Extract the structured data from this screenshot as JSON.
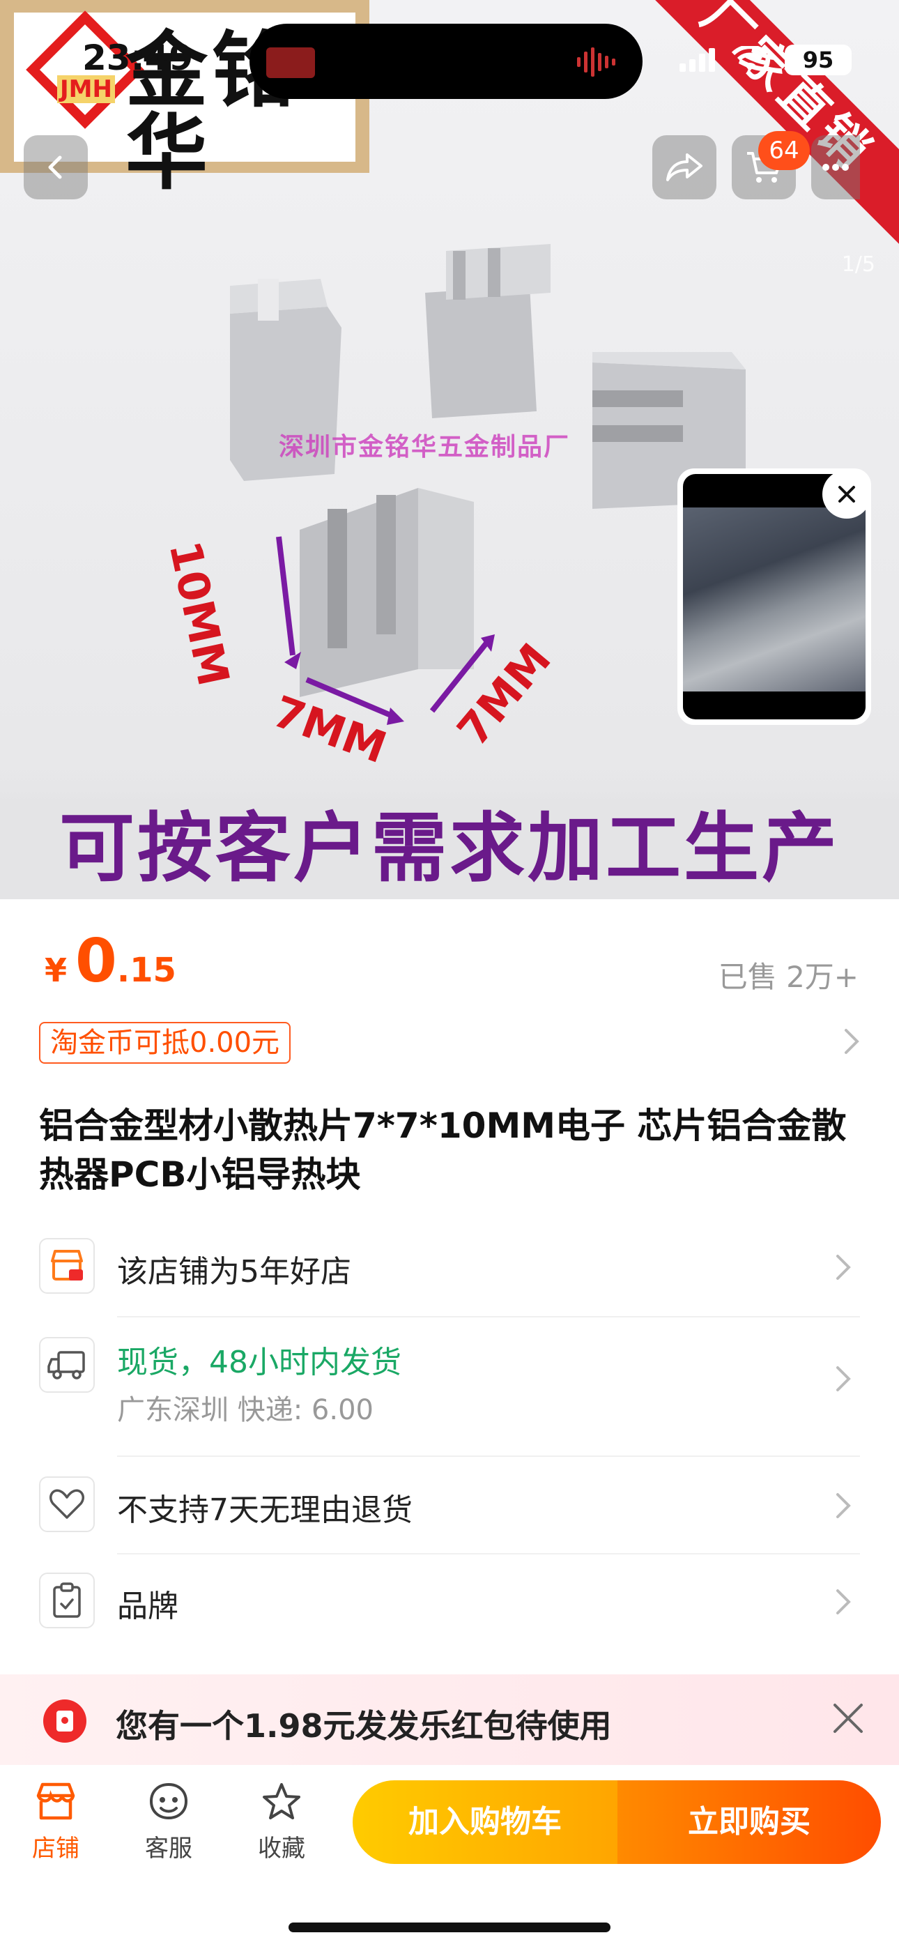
{
  "status_bar": {
    "time": "23:49",
    "battery": "95"
  },
  "hero": {
    "logo_text": "金铭华",
    "logo_badge": "JMH",
    "ribbon_text": "厂家直销",
    "watermark": "深圳市金铭华五金制品厂",
    "dim_height": "10MM",
    "dim_width": "7MM",
    "dim_depth": "7MM",
    "caption": "可按客户需求加工生产",
    "image_counter": "1/5",
    "cart_badge": "64"
  },
  "product": {
    "currency": "¥",
    "price_int": "0",
    "price_dec": ".15",
    "sold": "已售 2万+",
    "coin_tag": "淘金币可抵0.00元",
    "title": "铝合金型材小散热片7*7*10MM电子 芯片铝合金散热器PCB小铝导热块"
  },
  "info_rows": {
    "store": "该店铺为5年好店",
    "shipping_main": "现货，48小时内发货",
    "shipping_sub": "广东深圳  快递: 6.00",
    "returns": "不支持7天无理由退货",
    "brand": "品牌"
  },
  "coupon": {
    "text": "您有一个1.98元发发乐红包待使用"
  },
  "bottom_bar": {
    "store_label": "店铺",
    "service_label": "客服",
    "favorite_label": "收藏",
    "add_to_cart": "加入购物车",
    "buy_now": "立即购买"
  },
  "colors": {
    "accent": "#ff4f00",
    "green": "#1aa865",
    "cart_cta": "#ffb800",
    "buy_cta": "#ff5a00"
  }
}
